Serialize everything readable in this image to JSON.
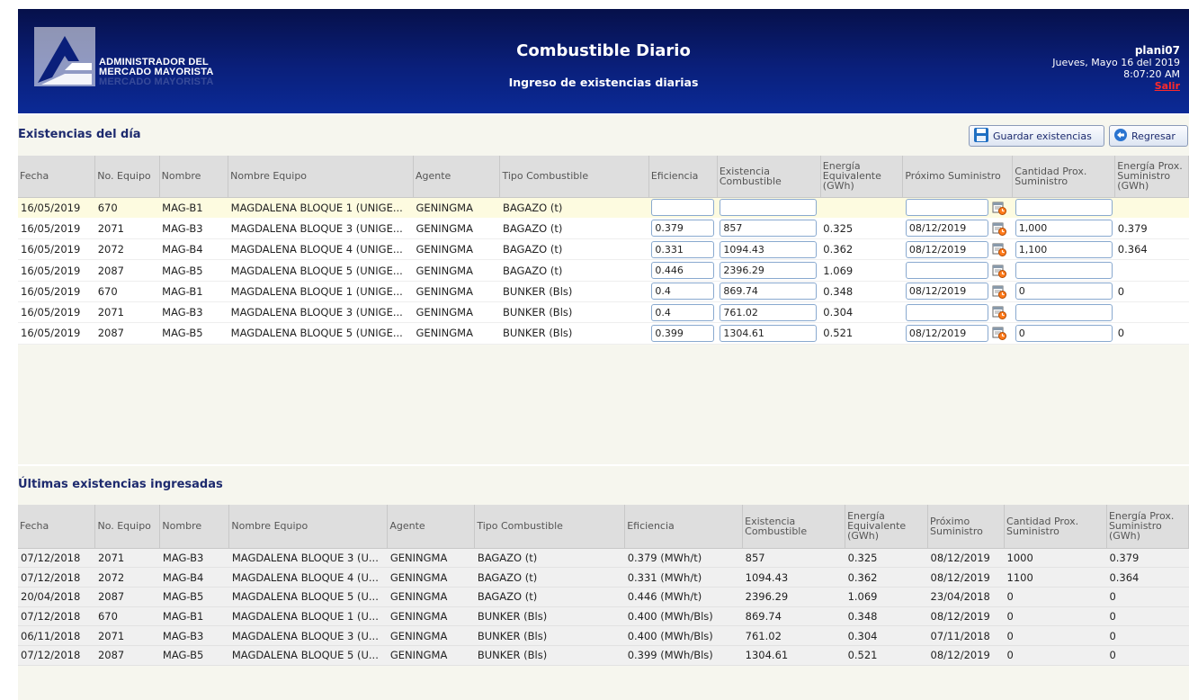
{
  "header": {
    "logo_line1": "ADMINISTRADOR DEL",
    "logo_line2": "MERCADO MAYORISTA",
    "logo_reflection": "MERCADO MAYORISTA",
    "title": "Combustible Diario",
    "subtitle": "Ingreso de existencias diarias",
    "username": "plani07",
    "date": "Jueves, Mayo 16 del 2019",
    "time": "8:07:20 AM",
    "logout": "Salir"
  },
  "existencias": {
    "title": "Existencias del día",
    "save_label": "Guardar existencias",
    "back_label": "Regresar",
    "columns": [
      "Fecha",
      "No. Equipo",
      "Nombre",
      "Nombre Equipo",
      "Agente",
      "Tipo Combustible",
      "Eficiencia",
      "Existencia Combustible",
      "Energía Equivalente (GWh)",
      "Próximo Suministro",
      "Cantidad Prox. Suministro",
      "Energía Prox. Suministro (GWh)"
    ],
    "rows": [
      {
        "fecha": "16/05/2019",
        "equipo": "670",
        "nombre": "MAG-B1",
        "nombre_equipo": "MAGDALENA BLOQUE 1 (UNIGE...",
        "agente": "GENINGMA",
        "tipo": "BAGAZO (t)",
        "eficiencia": "",
        "existencia": "",
        "energia": "",
        "proximo": "",
        "cantidad": "",
        "energia_prox": ""
      },
      {
        "fecha": "16/05/2019",
        "equipo": "2071",
        "nombre": "MAG-B3",
        "nombre_equipo": "MAGDALENA BLOQUE 3 (UNIGE...",
        "agente": "GENINGMA",
        "tipo": "BAGAZO (t)",
        "eficiencia": "0.379",
        "existencia": "857",
        "energia": "0.325",
        "proximo": "08/12/2019",
        "cantidad": "1,000",
        "energia_prox": "0.379"
      },
      {
        "fecha": "16/05/2019",
        "equipo": "2072",
        "nombre": "MAG-B4",
        "nombre_equipo": "MAGDALENA BLOQUE 4 (UNIGE...",
        "agente": "GENINGMA",
        "tipo": "BAGAZO (t)",
        "eficiencia": "0.331",
        "existencia": "1094.43",
        "energia": "0.362",
        "proximo": "08/12/2019",
        "cantidad": "1,100",
        "energia_prox": "0.364"
      },
      {
        "fecha": "16/05/2019",
        "equipo": "2087",
        "nombre": "MAG-B5",
        "nombre_equipo": "MAGDALENA BLOQUE 5 (UNIGE...",
        "agente": "GENINGMA",
        "tipo": "BAGAZO (t)",
        "eficiencia": "0.446",
        "existencia": "2396.29",
        "energia": "1.069",
        "proximo": "",
        "cantidad": "",
        "energia_prox": ""
      },
      {
        "fecha": "16/05/2019",
        "equipo": "670",
        "nombre": "MAG-B1",
        "nombre_equipo": "MAGDALENA BLOQUE 1 (UNIGE...",
        "agente": "GENINGMA",
        "tipo": "BUNKER (Bls)",
        "eficiencia": "0.4",
        "existencia": "869.74",
        "energia": "0.348",
        "proximo": "08/12/2019",
        "cantidad": "0",
        "energia_prox": "0"
      },
      {
        "fecha": "16/05/2019",
        "equipo": "2071",
        "nombre": "MAG-B3",
        "nombre_equipo": "MAGDALENA BLOQUE 3 (UNIGE...",
        "agente": "GENINGMA",
        "tipo": "BUNKER (Bls)",
        "eficiencia": "0.4",
        "existencia": "761.02",
        "energia": "0.304",
        "proximo": "",
        "cantidad": "",
        "energia_prox": ""
      },
      {
        "fecha": "16/05/2019",
        "equipo": "2087",
        "nombre": "MAG-B5",
        "nombre_equipo": "MAGDALENA BLOQUE 5 (UNIGE...",
        "agente": "GENINGMA",
        "tipo": "BUNKER (Bls)",
        "eficiencia": "0.399",
        "existencia": "1304.61",
        "energia": "0.521",
        "proximo": "08/12/2019",
        "cantidad": "0",
        "energia_prox": "0"
      }
    ]
  },
  "ultimas": {
    "title": "Últimas existencias ingresadas",
    "columns": [
      "Fecha",
      "No. Equipo",
      "Nombre",
      "Nombre Equipo",
      "Agente",
      "Tipo Combustible",
      "Eficiencia",
      "Existencia Combustible",
      "Energía Equivalente (GWh)",
      "Próximo Suministro",
      "Cantidad Prox. Suministro",
      "Energía Prox. Suministro (GWh)"
    ],
    "rows": [
      [
        "07/12/2018",
        "2071",
        "MAG-B3",
        "MAGDALENA BLOQUE 3 (U...",
        "GENINGMA",
        "BAGAZO (t)",
        "0.379 (MWh/t)",
        "857",
        "0.325",
        "08/12/2019",
        "1000",
        "0.379"
      ],
      [
        "07/12/2018",
        "2072",
        "MAG-B4",
        "MAGDALENA BLOQUE 4 (U...",
        "GENINGMA",
        "BAGAZO (t)",
        "0.331 (MWh/t)",
        "1094.43",
        "0.362",
        "08/12/2019",
        "1100",
        "0.364"
      ],
      [
        "20/04/2018",
        "2087",
        "MAG-B5",
        "MAGDALENA BLOQUE 5 (U...",
        "GENINGMA",
        "BAGAZO (t)",
        "0.446 (MWh/t)",
        "2396.29",
        "1.069",
        "23/04/2018",
        "0",
        "0"
      ],
      [
        "07/12/2018",
        "670",
        "MAG-B1",
        "MAGDALENA BLOQUE 1 (U...",
        "GENINGMA",
        "BUNKER (Bls)",
        "0.400 (MWh/Bls)",
        "869.74",
        "0.348",
        "08/12/2019",
        "0",
        "0"
      ],
      [
        "06/11/2018",
        "2071",
        "MAG-B3",
        "MAGDALENA BLOQUE 3 (U...",
        "GENINGMA",
        "BUNKER (Bls)",
        "0.400 (MWh/Bls)",
        "761.02",
        "0.304",
        "07/11/2018",
        "0",
        "0"
      ],
      [
        "07/12/2018",
        "2087",
        "MAG-B5",
        "MAGDALENA BLOQUE 5 (U...",
        "GENINGMA",
        "BUNKER (Bls)",
        "0.399 (MWh/Bls)",
        "1304.61",
        "0.521",
        "08/12/2019",
        "0",
        "0"
      ]
    ]
  },
  "icons": {
    "save": "floppy-disk-icon",
    "back": "arrow-left-circle-icon",
    "calendar": "calendar-clock-icon"
  },
  "colors": {
    "header_dark": "#06104a",
    "header_light": "#0b2a96",
    "logout": "#ff2a2a",
    "section_title": "#1d2a6e",
    "input_border": "#89a9cf",
    "panel_bg": "#f6f6ee",
    "selected_row": "#fdfbe0"
  }
}
